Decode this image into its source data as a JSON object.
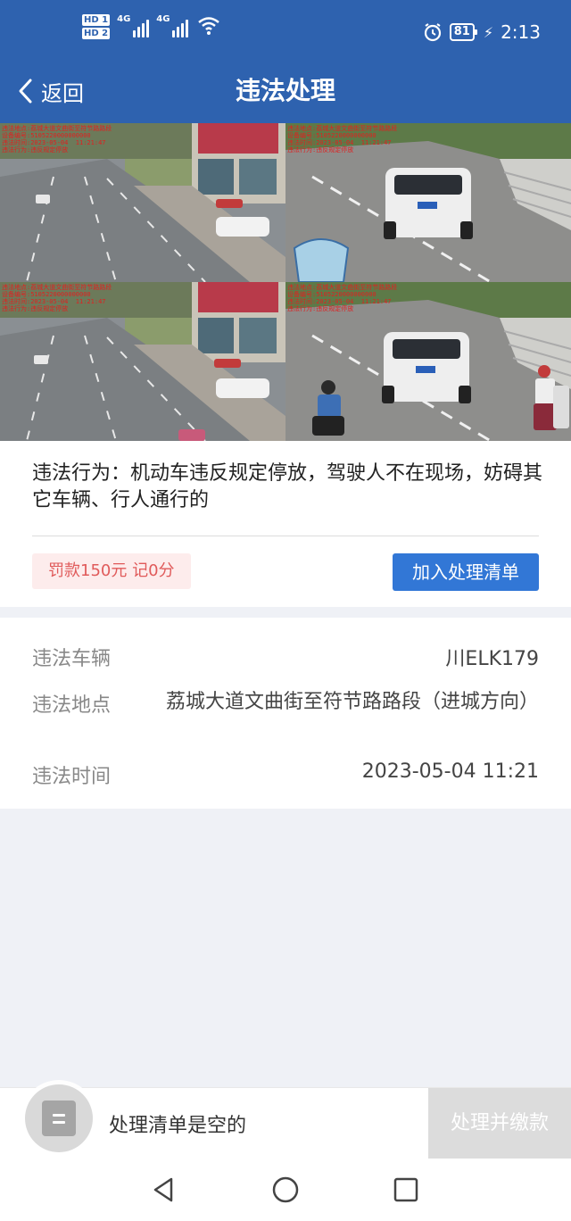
{
  "status_bar": {
    "sim1": "HD 1",
    "sim2": "HD 2",
    "net1": "4G",
    "net2": "4G",
    "battery": "81",
    "time": "2:13"
  },
  "header": {
    "back_label": "返回",
    "title": "违法处理"
  },
  "photos": {
    "stamp_lines": [
      "违法地点:荔城大道文曲街至符节路路段",
      "设备编号:5105220000000000",
      "违法时间:2023-05-04  11:21:47",
      "违法行为:违反规定停放"
    ]
  },
  "violation": {
    "behavior": "违法行为：机动车违反规定停放，驾驶人不在现场，妨碍其它车辆、行人通行的",
    "fine": "罚款150元 记0分",
    "add_button": "加入处理清单"
  },
  "details": {
    "vehicle_label": "违法车辆",
    "vehicle_value": "川ELK179",
    "location_label": "违法地点",
    "location_value": "荔城大道文曲街至符节路路段（进城方向）",
    "time_label": "违法时间",
    "time_value": "2023-05-04 11:21"
  },
  "bottom_bar": {
    "empty_text": "处理清单是空的",
    "pay_button": "处理并缴款"
  },
  "colors": {
    "primary": "#2e62af",
    "button": "#3277d6",
    "fine_text": "#e05a5a",
    "fine_bg": "#fdecec",
    "disabled": "#dcdcdc"
  },
  "icons": [
    "back-chevron-icon",
    "alarm-icon",
    "wifi-icon",
    "list-icon",
    "nav-back-icon",
    "nav-home-icon",
    "nav-recents-icon"
  ]
}
